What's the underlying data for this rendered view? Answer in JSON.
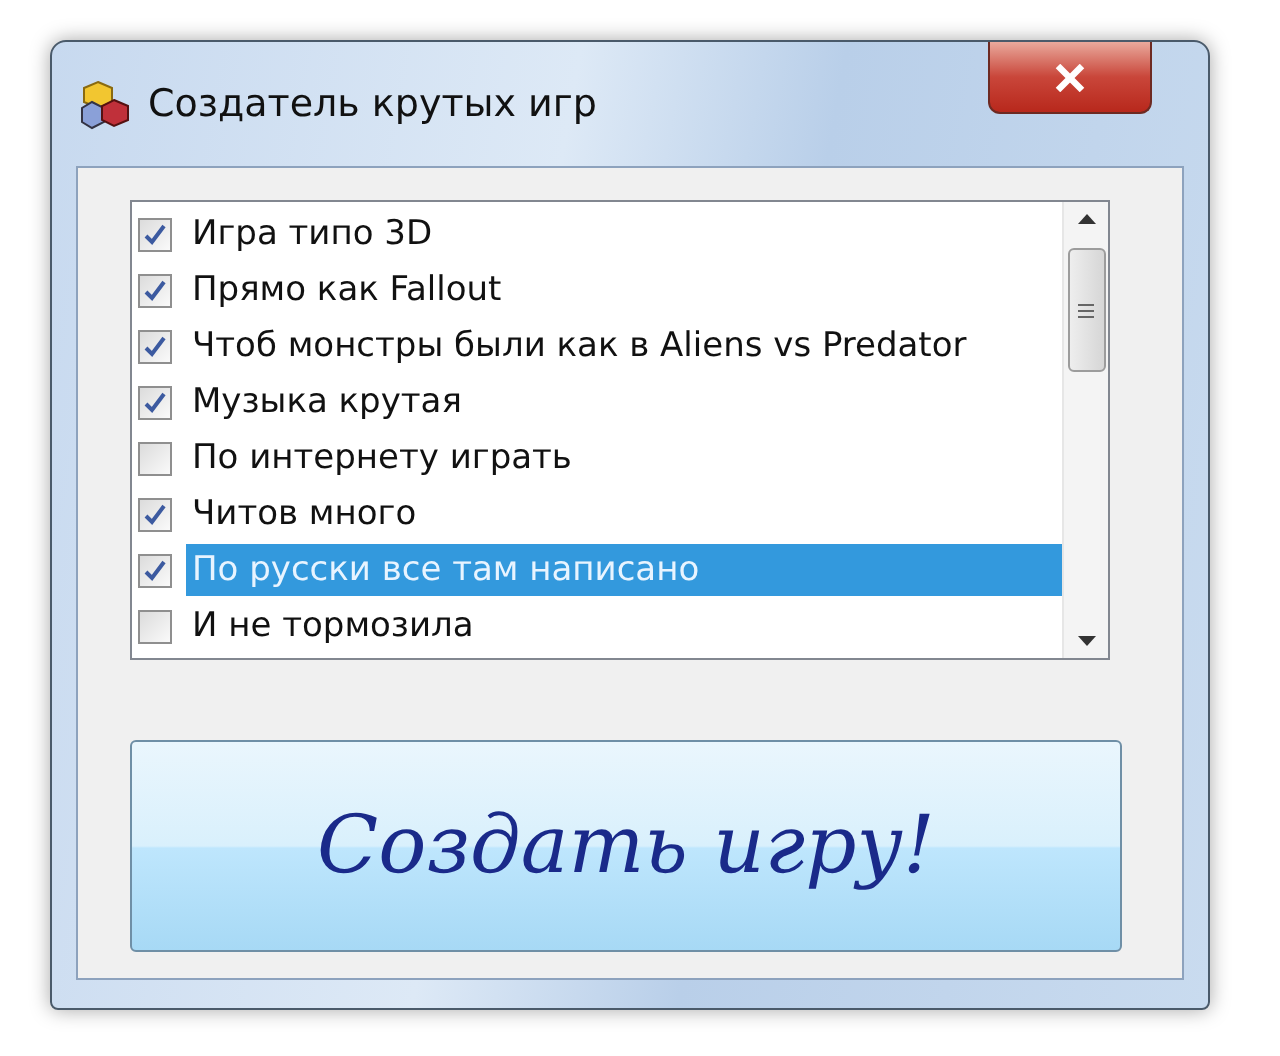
{
  "window": {
    "title": "Создатель крутых игр"
  },
  "checklist": {
    "items": [
      {
        "label": "Игра типо 3D",
        "checked": true,
        "selected": false
      },
      {
        "label": "Прямо как Fallout",
        "checked": true,
        "selected": false
      },
      {
        "label": "Чтоб монстры были как в Aliens vs Predator",
        "checked": true,
        "selected": false
      },
      {
        "label": "Музыка крутая",
        "checked": true,
        "selected": false
      },
      {
        "label": "По интернету играть",
        "checked": false,
        "selected": false
      },
      {
        "label": "Читов много",
        "checked": true,
        "selected": false
      },
      {
        "label": "По русски все там написано",
        "checked": true,
        "selected": true
      },
      {
        "label": "И не тормозила",
        "checked": false,
        "selected": false
      }
    ]
  },
  "create_button": {
    "label": "Создать игру!"
  }
}
